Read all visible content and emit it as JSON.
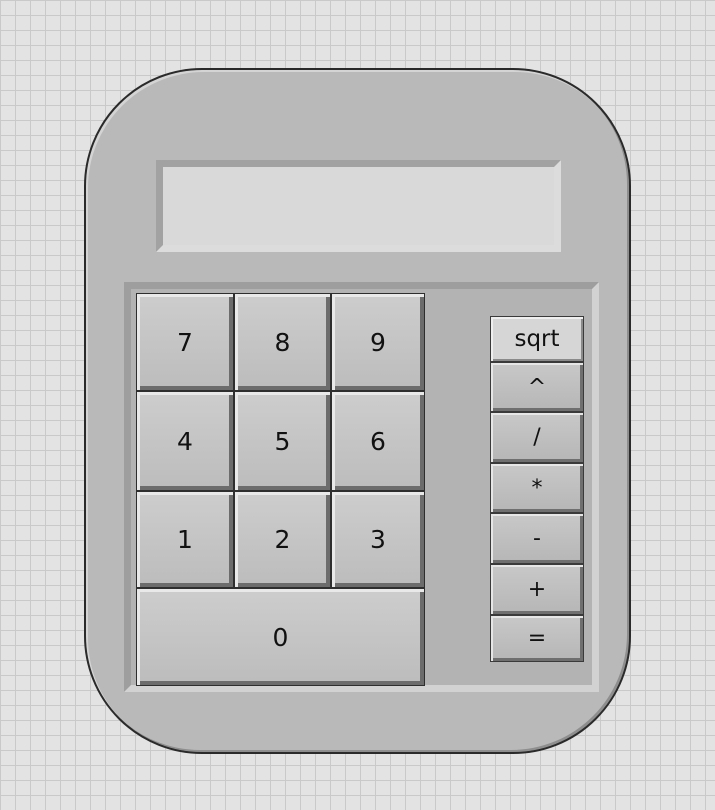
{
  "display": {
    "value": ""
  },
  "keypad": {
    "digits": [
      {
        "label": "7"
      },
      {
        "label": "8"
      },
      {
        "label": "9"
      },
      {
        "label": "4"
      },
      {
        "label": "5"
      },
      {
        "label": "6"
      },
      {
        "label": "1"
      },
      {
        "label": "2"
      },
      {
        "label": "3"
      },
      {
        "label": "0"
      }
    ]
  },
  "operators": [
    {
      "label": "sqrt"
    },
    {
      "label": "^"
    },
    {
      "label": "/"
    },
    {
      "label": "*"
    },
    {
      "label": "-"
    },
    {
      "label": "+"
    },
    {
      "label": "="
    }
  ],
  "colors": {
    "background": "#e3e3e3",
    "body": "#b9b9b9",
    "display": "#d9d9d9",
    "button_face": "#c4c4c4"
  }
}
